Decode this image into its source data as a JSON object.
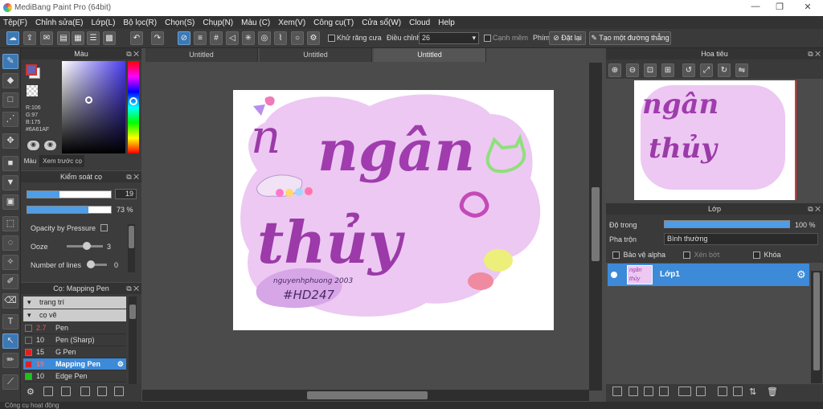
{
  "app": {
    "title": "MediBang Paint Pro (64bit)"
  },
  "menu": [
    "Tệp(F)",
    "Chỉnh sửa(E)",
    "Lớp(L)",
    "Bộ lọc(R)",
    "Chọn(S)",
    "Chụp(N)",
    "Màu (C)",
    "Xem(V)",
    "Công cụ(T)",
    "Cửa sổ(W)",
    "Cloud",
    "Help"
  ],
  "toolbar": {
    "antialias_label": "Khử răng cưa",
    "adjust_label": "Điều chỉnh",
    "adjust_value": "26",
    "edge_label": "Cạnh mềm",
    "key_label": "Phím",
    "reset_label": "Đặt lại",
    "create_line_label": "Tạo một đường thẳng"
  },
  "color_panel": {
    "title": "Màu",
    "r": "R:106",
    "g": "G:97",
    "b": "B:175",
    "hex": "#6A61AF",
    "tab_color": "Màu",
    "tab_preview": "Xem trước cọ",
    "current_color": "#6A61AF"
  },
  "brush_control": {
    "title": "Kiểm soát cọ",
    "size_value": "19",
    "size_fraction": 0.38,
    "opacity_value": "73 %",
    "opacity_fraction": 0.73,
    "opacity_pressure_label": "Opacity by Pressure",
    "ooze_label": "Ooze",
    "ooze_value": "3",
    "lines_label": "Number of lines",
    "lines_value": "0"
  },
  "brush_list": {
    "title": "Cọ: Mapping Pen",
    "groups": [
      "trang trí",
      "cọ vẽ"
    ],
    "items": [
      {
        "size": "2.7",
        "name": "Pen",
        "color": "#3a3a3a",
        "selected": false
      },
      {
        "size": "10",
        "name": "Pen (Sharp)",
        "color": "#3a3a3a",
        "selected": false
      },
      {
        "size": "15",
        "name": "G Pen",
        "color": "#e02020",
        "selected": false
      },
      {
        "size": "19",
        "name": "Mapping Pen",
        "color": "#e02020",
        "selected": true
      },
      {
        "size": "10",
        "name": "Edge Pen",
        "color": "#20c020",
        "selected": false
      }
    ]
  },
  "tabs": [
    "Untitled",
    "Untitled",
    "Untitled"
  ],
  "artwork": {
    "line1": "ngân",
    "line2": "thủy",
    "signature": "nguyenhphuong 2003",
    "tag": "#HD247",
    "prefix": "n"
  },
  "navigator": {
    "title": "Hoa tiêu"
  },
  "layers": {
    "title": "Lớp",
    "opacity_label": "Độ trong",
    "opacity_value": "100 %",
    "opacity_fraction": 1.0,
    "blend_label": "Pha trộn",
    "blend_value": "Bình thường",
    "protect_alpha": "Bảo vệ alpha",
    "clipping": "Xén bớt",
    "lock": "Khóa",
    "layer_name": "Lớp1"
  },
  "status": {
    "text": "Công cụ hoạt động"
  }
}
